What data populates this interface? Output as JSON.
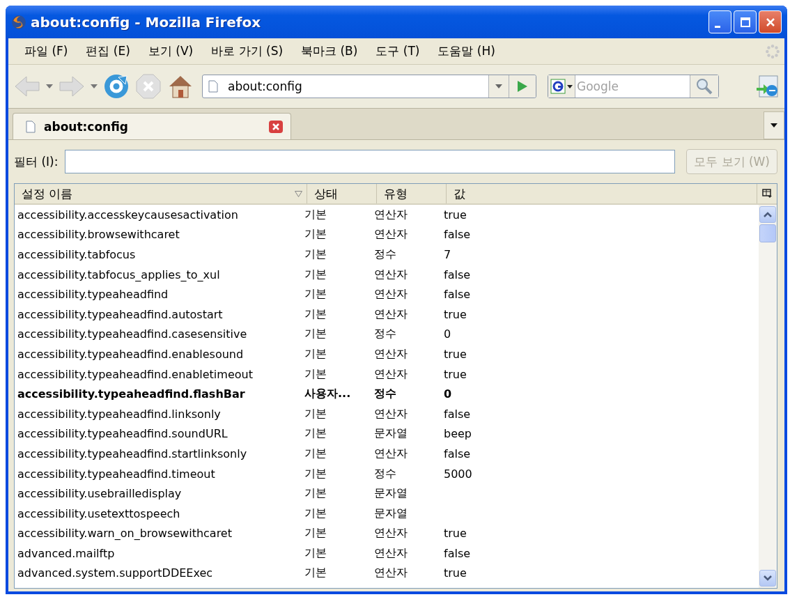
{
  "window": {
    "title": "about:config - Mozilla Firefox"
  },
  "menu": [
    "파일 (F)",
    "편집 (E)",
    "보기 (V)",
    "바로 가기 (S)",
    "북마크 (B)",
    "도구 (T)",
    "도움말 (H)"
  ],
  "toolbar": {
    "back_disabled": true,
    "forward_disabled": true,
    "stop_disabled": true,
    "url": "about:config",
    "search_placeholder": "Google"
  },
  "tabs": [
    {
      "label": "about:config",
      "selected": true
    }
  ],
  "filter": {
    "label": "필터 (I):",
    "button": "모두 보기 (W)",
    "button_disabled": true
  },
  "table": {
    "columns": [
      "설정 이름",
      "상태",
      "유형",
      "값"
    ],
    "rows": [
      {
        "name": "accessibility.accesskeycausesactivation",
        "status": "기본",
        "type": "연산자",
        "value": "true",
        "modified": false
      },
      {
        "name": "accessibility.browsewithcaret",
        "status": "기본",
        "type": "연산자",
        "value": "false",
        "modified": false
      },
      {
        "name": "accessibility.tabfocus",
        "status": "기본",
        "type": "정수",
        "value": "7",
        "modified": false
      },
      {
        "name": "accessibility.tabfocus_applies_to_xul",
        "status": "기본",
        "type": "연산자",
        "value": "false",
        "modified": false
      },
      {
        "name": "accessibility.typeaheadfind",
        "status": "기본",
        "type": "연산자",
        "value": "false",
        "modified": false
      },
      {
        "name": "accessibility.typeaheadfind.autostart",
        "status": "기본",
        "type": "연산자",
        "value": "true",
        "modified": false
      },
      {
        "name": "accessibility.typeaheadfind.casesensitive",
        "status": "기본",
        "type": "정수",
        "value": "0",
        "modified": false
      },
      {
        "name": "accessibility.typeaheadfind.enablesound",
        "status": "기본",
        "type": "연산자",
        "value": "true",
        "modified": false
      },
      {
        "name": "accessibility.typeaheadfind.enabletimeout",
        "status": "기본",
        "type": "연산자",
        "value": "true",
        "modified": false
      },
      {
        "name": "accessibility.typeaheadfind.flashBar",
        "status": "사용자...",
        "type": "정수",
        "value": "0",
        "modified": true
      },
      {
        "name": "accessibility.typeaheadfind.linksonly",
        "status": "기본",
        "type": "연산자",
        "value": "false",
        "modified": false
      },
      {
        "name": "accessibility.typeaheadfind.soundURL",
        "status": "기본",
        "type": "문자열",
        "value": "beep",
        "modified": false
      },
      {
        "name": "accessibility.typeaheadfind.startlinksonly",
        "status": "기본",
        "type": "연산자",
        "value": "false",
        "modified": false
      },
      {
        "name": "accessibility.typeaheadfind.timeout",
        "status": "기본",
        "type": "정수",
        "value": "5000",
        "modified": false
      },
      {
        "name": "accessibility.usebrailledisplay",
        "status": "기본",
        "type": "문자열",
        "modified": false
      },
      {
        "name": "accessibility.usetexttospeech",
        "status": "기본",
        "type": "문자열",
        "modified": false
      },
      {
        "name": "accessibility.warn_on_browsewithcaret",
        "status": "기본",
        "type": "연산자",
        "value": "true",
        "modified": false
      },
      {
        "name": "advanced.mailftp",
        "status": "기본",
        "type": "연산자",
        "value": "false",
        "modified": false
      },
      {
        "name": "advanced.system.supportDDEExec",
        "status": "기본",
        "type": "연산자",
        "value": "true",
        "modified": false
      }
    ]
  }
}
